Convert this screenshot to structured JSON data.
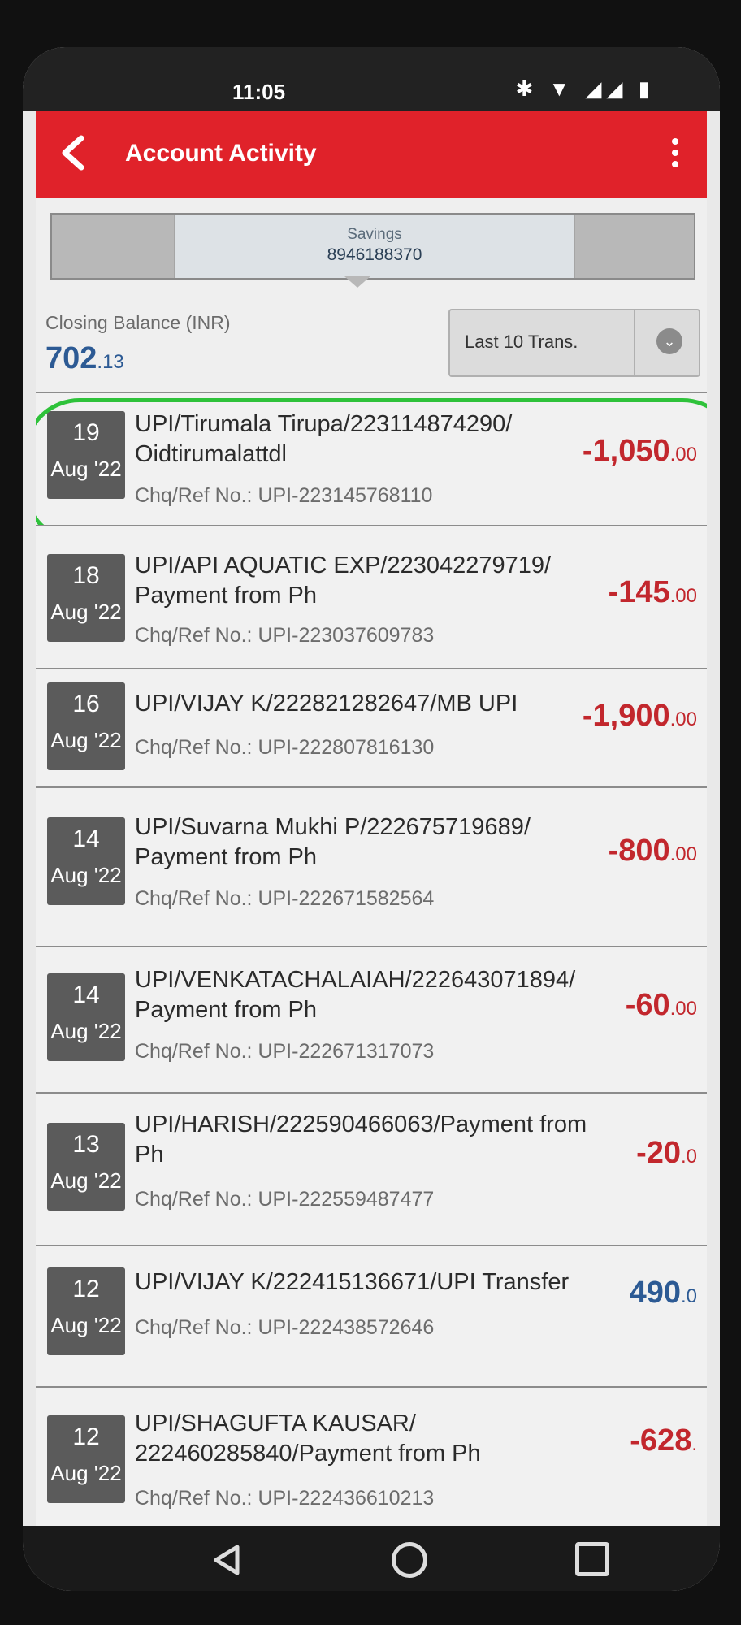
{
  "status": {
    "time": "11:05",
    "icons": "✱ ▼ ◢◢ ▮"
  },
  "appbar": {
    "title": "Account Activity"
  },
  "account": {
    "type": "Savings",
    "number": "8946188370"
  },
  "balance": {
    "label": "Closing Balance (INR)",
    "int": "702",
    "dec": ".13"
  },
  "filter": {
    "label": "Last 10 Trans.",
    "chevron": "⌄"
  },
  "colors": {
    "accent": "#e0222a",
    "debit": "#c2272d",
    "credit": "#2c5a94",
    "highlight": "#2ec23a"
  },
  "transactions": [
    {
      "day": "19",
      "month": "Aug '22",
      "desc": "UPI/Tirumala Tirupa/223114874290/ Oidtirumalattdl",
      "ref": "Chq/Ref No.: UPI-223145768110",
      "amount_int": "-1,050",
      "amount_dec": ".00",
      "type": "debit"
    },
    {
      "day": "18",
      "month": "Aug '22",
      "desc": "UPI/API AQUATIC EXP/223042279719/ Payment from Ph",
      "ref": "Chq/Ref No.: UPI-223037609783",
      "amount_int": "-145",
      "amount_dec": ".00",
      "type": "debit"
    },
    {
      "day": "16",
      "month": "Aug '22",
      "desc": "UPI/VIJAY K/222821282647/MB UPI",
      "ref": "Chq/Ref No.: UPI-222807816130",
      "amount_int": "-1,900",
      "amount_dec": ".00",
      "type": "debit"
    },
    {
      "day": "14",
      "month": "Aug '22",
      "desc": "UPI/Suvarna Mukhi P/222675719689/ Payment from Ph",
      "ref": "Chq/Ref No.: UPI-222671582564",
      "amount_int": "-800",
      "amount_dec": ".00",
      "type": "debit"
    },
    {
      "day": "14",
      "month": "Aug '22",
      "desc": "UPI/VENKATACHALAIAH/222643071894/ Payment from Ph",
      "ref": "Chq/Ref No.: UPI-222671317073",
      "amount_int": "-60",
      "amount_dec": ".00",
      "type": "debit"
    },
    {
      "day": "13",
      "month": "Aug '22",
      "desc": "UPI/HARISH/222590466063/Payment from Ph",
      "ref": "Chq/Ref No.: UPI-222559487477",
      "amount_int": "-20",
      "amount_dec": ".0",
      "type": "debit"
    },
    {
      "day": "12",
      "month": "Aug '22",
      "desc": "UPI/VIJAY K/222415136671/UPI Transfer",
      "ref": "Chq/Ref No.: UPI-222438572646",
      "amount_int": "490",
      "amount_dec": ".0",
      "type": "credit"
    },
    {
      "day": "12",
      "month": "Aug '22",
      "desc": "UPI/SHAGUFTA KAUSAR/ 222460285840/Payment from Ph",
      "ref": "Chq/Ref No.: UPI-222436610213",
      "amount_int": "-628",
      "amount_dec": ".",
      "type": "debit"
    }
  ]
}
